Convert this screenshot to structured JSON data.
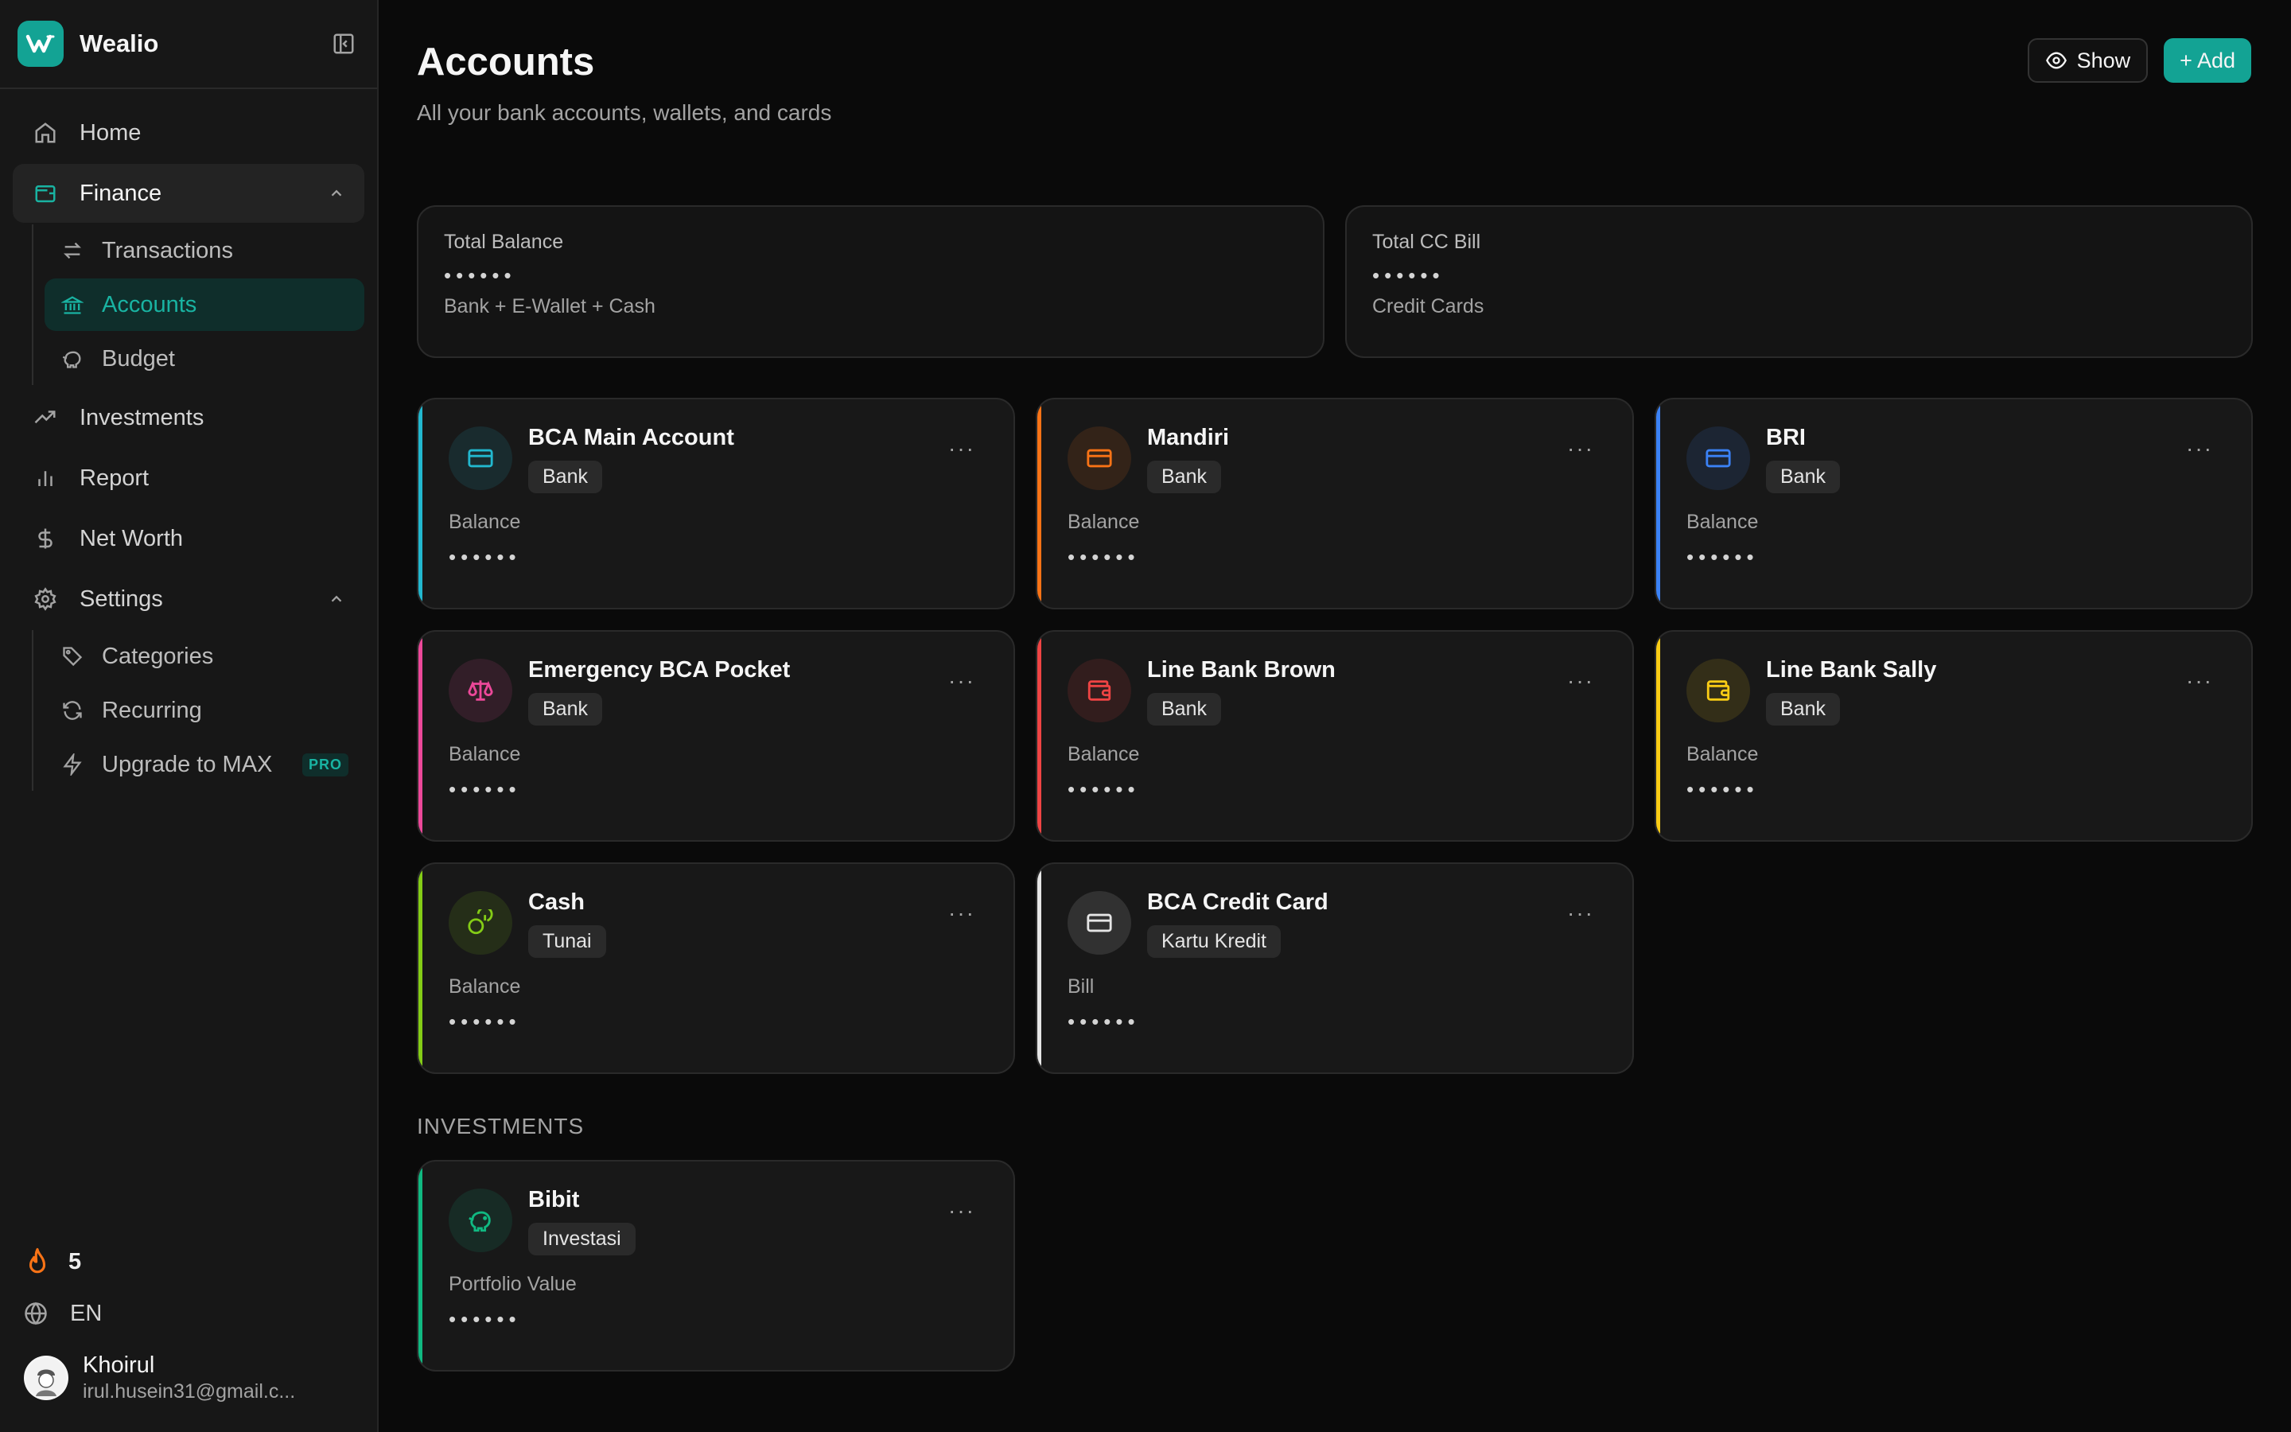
{
  "brand": {
    "name": "Wealio"
  },
  "nav": {
    "home": "Home",
    "finance": "Finance",
    "transactions": "Transactions",
    "accounts": "Accounts",
    "budget": "Budget",
    "investments": "Investments",
    "report": "Report",
    "net_worth": "Net Worth",
    "settings": "Settings",
    "categories": "Categories",
    "recurring": "Recurring",
    "upgrade": "Upgrade to MAX",
    "pro_badge": "PRO"
  },
  "footer": {
    "streak": "5",
    "language": "EN",
    "user_name": "Khoirul",
    "user_email": "irul.husein31@gmail.c..."
  },
  "page": {
    "title": "Accounts",
    "subtitle": "All your bank accounts, wallets, and cards",
    "show_label": "Show",
    "add_label": "+ Add"
  },
  "totals": {
    "balance": {
      "label": "Total Balance",
      "value": "••••••",
      "note": "Bank + E-Wallet + Cash"
    },
    "cc": {
      "label": "Total CC Bill",
      "value": "••••••",
      "note": "Credit Cards"
    }
  },
  "accounts": [
    {
      "name": "BCA Main Account",
      "type": "Bank",
      "label": "Balance",
      "value": "••••••",
      "accent": "#22b8cf",
      "icon": "card-icon"
    },
    {
      "name": "Mandiri",
      "type": "Bank",
      "label": "Balance",
      "value": "••••••",
      "accent": "#f97316",
      "icon": "card-icon"
    },
    {
      "name": "BRI",
      "type": "Bank",
      "label": "Balance",
      "value": "••••••",
      "accent": "#3b82f6",
      "icon": "card-icon"
    },
    {
      "name": "Emergency BCA Pocket",
      "type": "Bank",
      "label": "Balance",
      "value": "••••••",
      "accent": "#ec4899",
      "icon": "scale-icon"
    },
    {
      "name": "Line Bank Brown",
      "type": "Bank",
      "label": "Balance",
      "value": "••••••",
      "accent": "#ef4444",
      "icon": "wallet-icon"
    },
    {
      "name": "Line Bank Sally",
      "type": "Bank",
      "label": "Balance",
      "value": "••••••",
      "accent": "#facc15",
      "icon": "wallet-icon"
    },
    {
      "name": "Cash",
      "type": "Tunai",
      "label": "Balance",
      "value": "••••••",
      "accent": "#84cc16",
      "icon": "coins-icon"
    },
    {
      "name": "BCA Credit Card",
      "type": "Kartu Kredit",
      "label": "Bill",
      "value": "••••••",
      "accent": "#e5e5e5",
      "icon": "credit-card-icon"
    }
  ],
  "investments": {
    "section_title": "INVESTMENTS",
    "items": [
      {
        "name": "Bibit",
        "type": "Investasi",
        "label": "Portfolio Value",
        "value": "••••••",
        "accent": "#10b981",
        "icon": "piggy-bank-icon"
      }
    ]
  },
  "more_label": "···"
}
